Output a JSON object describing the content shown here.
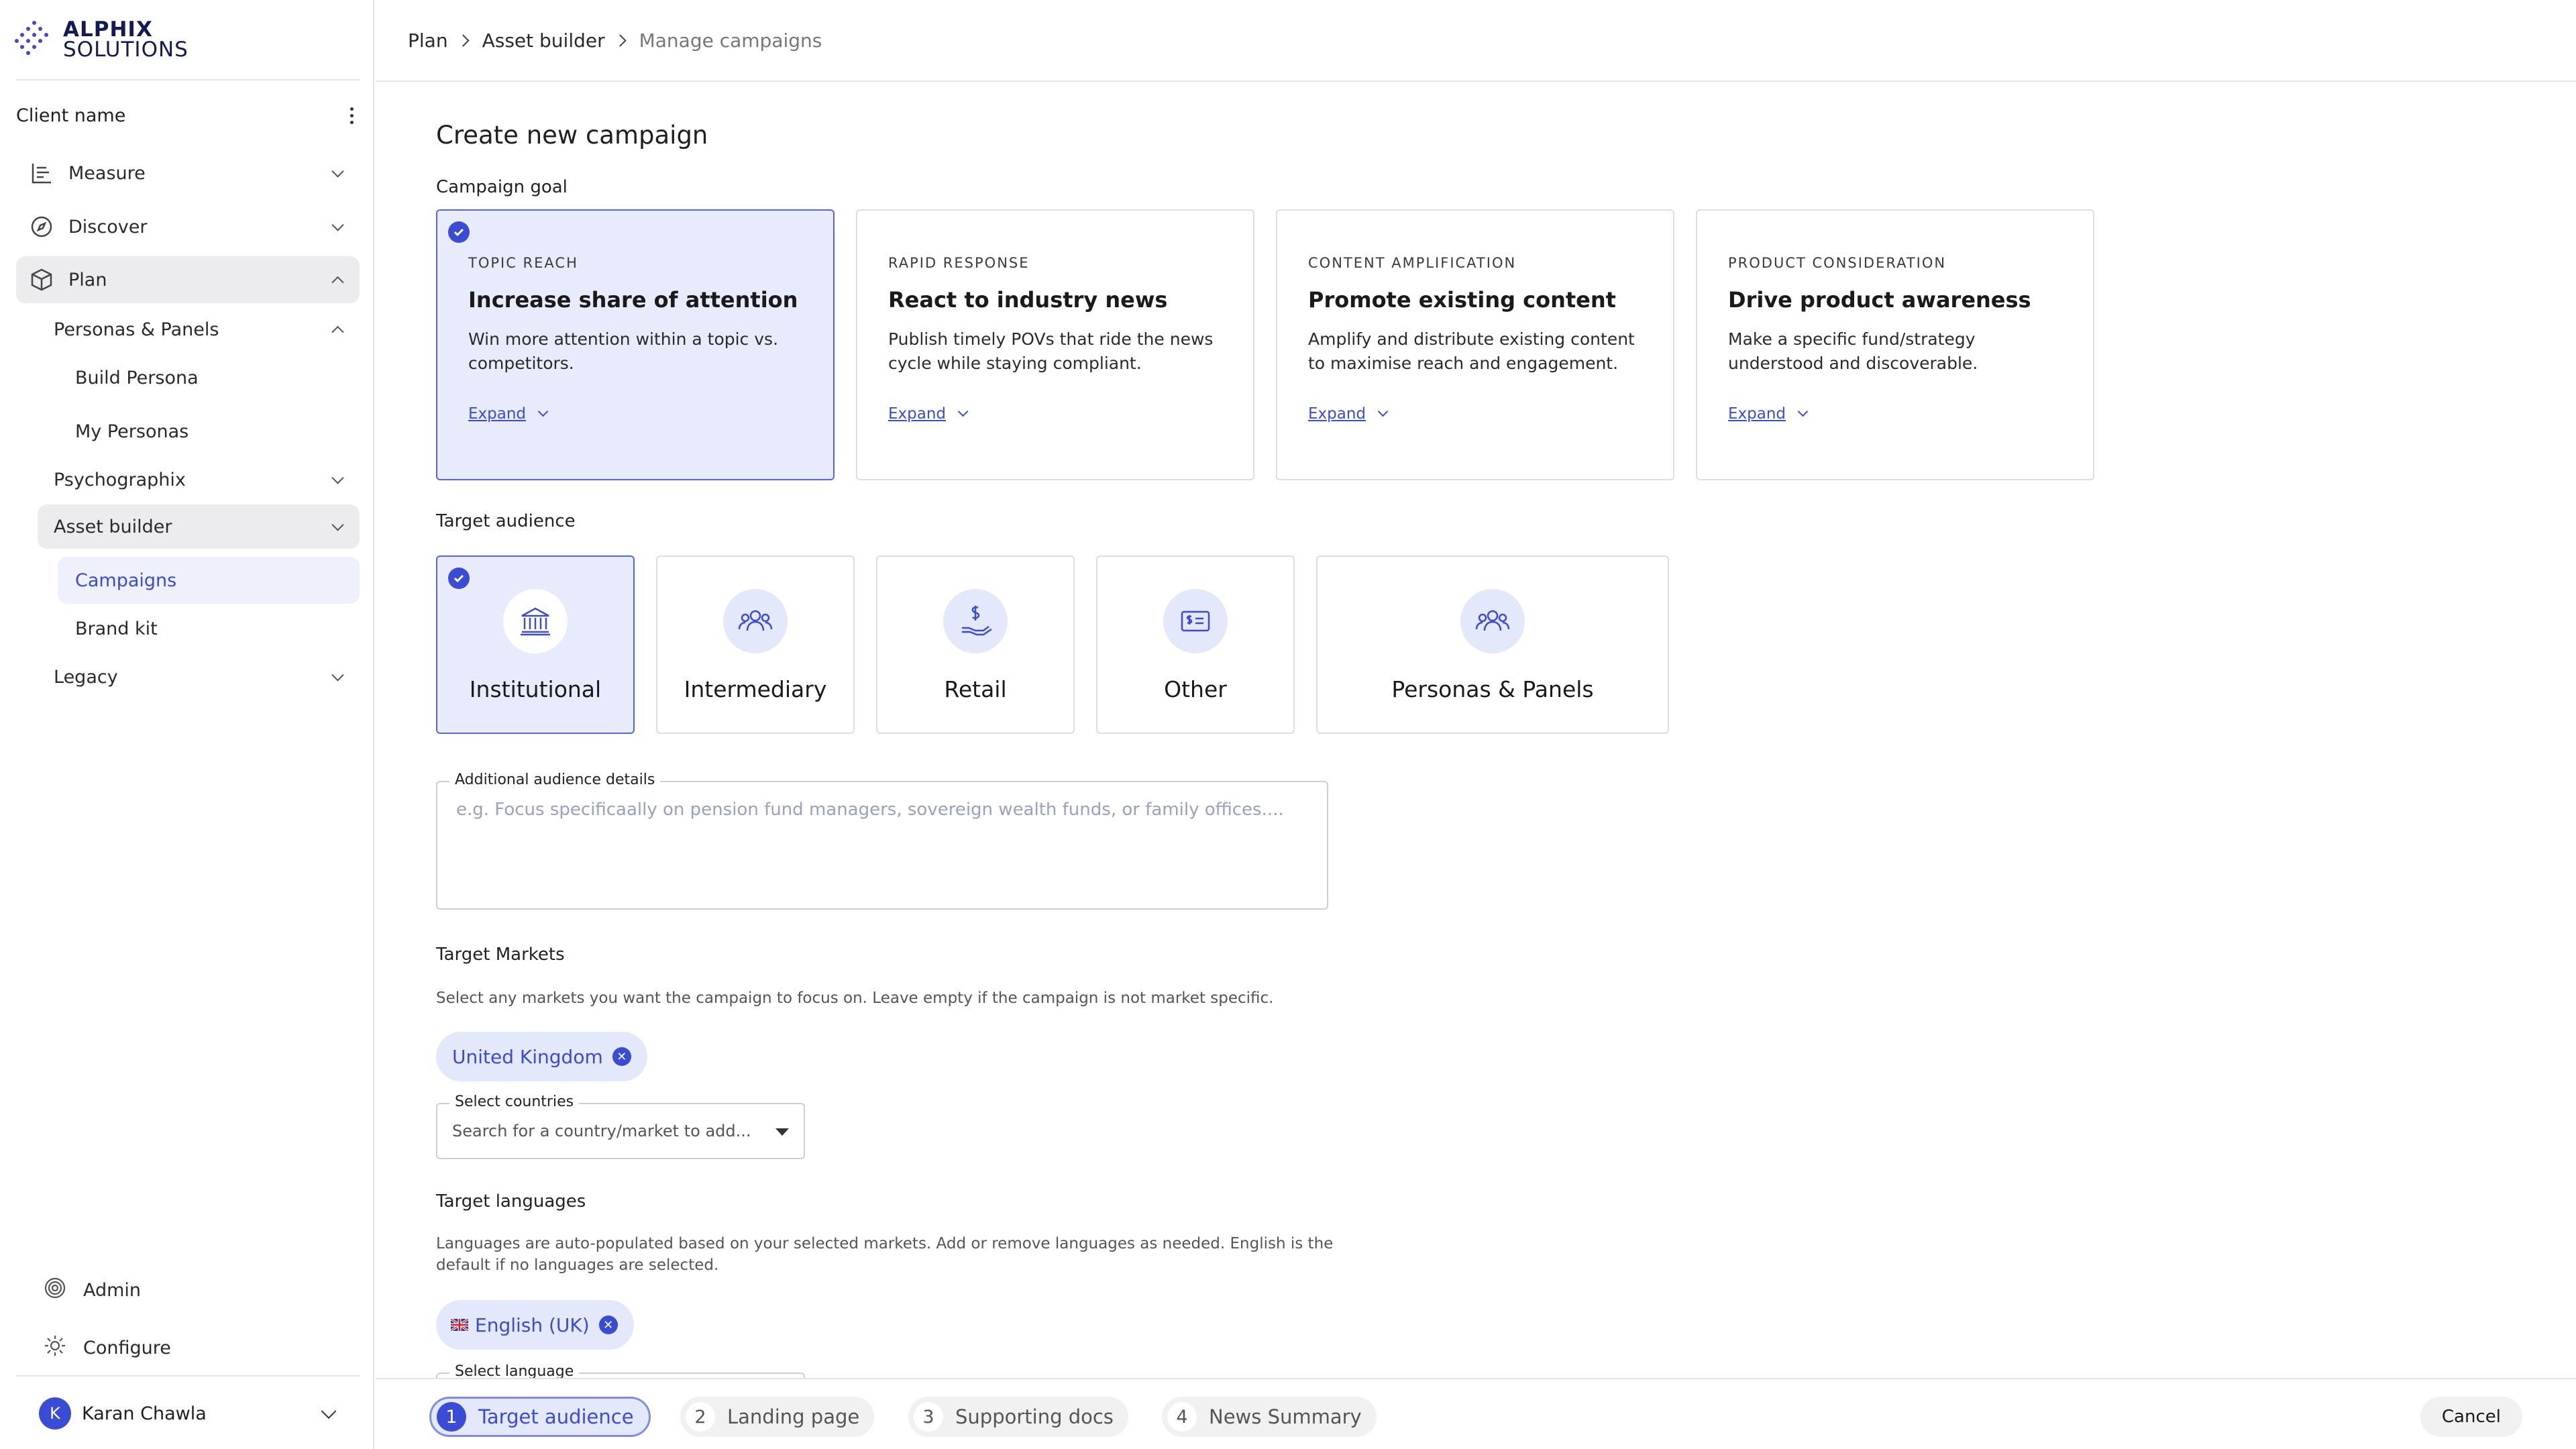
{
  "brand": {
    "line1": "ALPHIX",
    "line2": "SOLUTIONS",
    "accent": "#3a4bd6",
    "navy": "#141a55"
  },
  "sidebar": {
    "client_name": "Client name",
    "items": [
      {
        "label": "Measure",
        "icon": "bar-list-icon"
      },
      {
        "label": "Discover",
        "icon": "compass-icon"
      },
      {
        "label": "Plan",
        "icon": "cube-icon"
      },
      {
        "label": "Personas & Panels"
      },
      {
        "label": "Build Persona"
      },
      {
        "label": "My Personas"
      },
      {
        "label": "Psychographix"
      },
      {
        "label": "Asset builder"
      },
      {
        "label": "Campaigns"
      },
      {
        "label": "Brand kit"
      },
      {
        "label": "Legacy"
      }
    ],
    "admin": "Admin",
    "configure": "Configure",
    "user": {
      "initial": "K",
      "name": "Karan Chawla"
    }
  },
  "breadcrumb": [
    "Plan",
    "Asset builder",
    "Manage campaigns"
  ],
  "page_title": "Create new campaign",
  "campaign_goal": {
    "label": "Campaign goal",
    "options": [
      {
        "eyebrow": "TOPIC REACH",
        "title": "Increase share of attention",
        "desc": "Win more attention within a topic vs. competitors.",
        "expand": "Expand",
        "selected": true
      },
      {
        "eyebrow": "RAPID RESPONSE",
        "title": "React to industry news",
        "desc": "Publish timely POVs that ride the news cycle while staying compliant.",
        "expand": "Expand",
        "selected": false
      },
      {
        "eyebrow": "CONTENT AMPLIFICATION",
        "title": "Promote existing content",
        "desc": "Amplify and distribute existing content to maximise reach and engagement.",
        "expand": "Expand",
        "selected": false
      },
      {
        "eyebrow": "PRODUCT CONSIDERATION",
        "title": "Drive product awareness",
        "desc": "Make a specific fund/strategy understood and discoverable.",
        "expand": "Expand",
        "selected": false
      }
    ]
  },
  "target_audience": {
    "label": "Target audience",
    "options": [
      {
        "label": "Institutional",
        "icon": "bank-icon",
        "selected": true
      },
      {
        "label": "Intermediary",
        "icon": "people-group-icon",
        "selected": false
      },
      {
        "label": "Retail",
        "icon": "hand-dollar-icon",
        "selected": false
      },
      {
        "label": "Other",
        "icon": "id-card-dollar-icon",
        "selected": false
      },
      {
        "label": "Personas & Panels",
        "icon": "people-group-icon",
        "selected": false
      }
    ],
    "details_label": "Additional audience details",
    "details_placeholder": "e.g. Focus specificaally on pension fund managers, sovereign wealth funds, or family offices...."
  },
  "markets": {
    "label": "Target Markets",
    "help": "Select any markets you want the campaign to focus on. Leave empty if the campaign is not market specific.",
    "chips": [
      "United Kingdom"
    ],
    "select_label": "Select countries",
    "select_placeholder": "Search for a country/market to add..."
  },
  "languages": {
    "label": "Target languages",
    "help_line1": "Languages are auto-populated based on your selected markets. Add or remove languages as needed. English is the",
    "help_line2": "default if no languages are selected.",
    "chips": [
      "English (UK)"
    ],
    "select_label": "Select language"
  },
  "steps": [
    {
      "num": "1",
      "label": "Target audience",
      "active": true
    },
    {
      "num": "2",
      "label": "Landing page",
      "active": false
    },
    {
      "num": "3",
      "label": "Supporting docs",
      "active": false
    },
    {
      "num": "4",
      "label": "News Summary",
      "active": false
    }
  ],
  "cancel_label": "Cancel"
}
